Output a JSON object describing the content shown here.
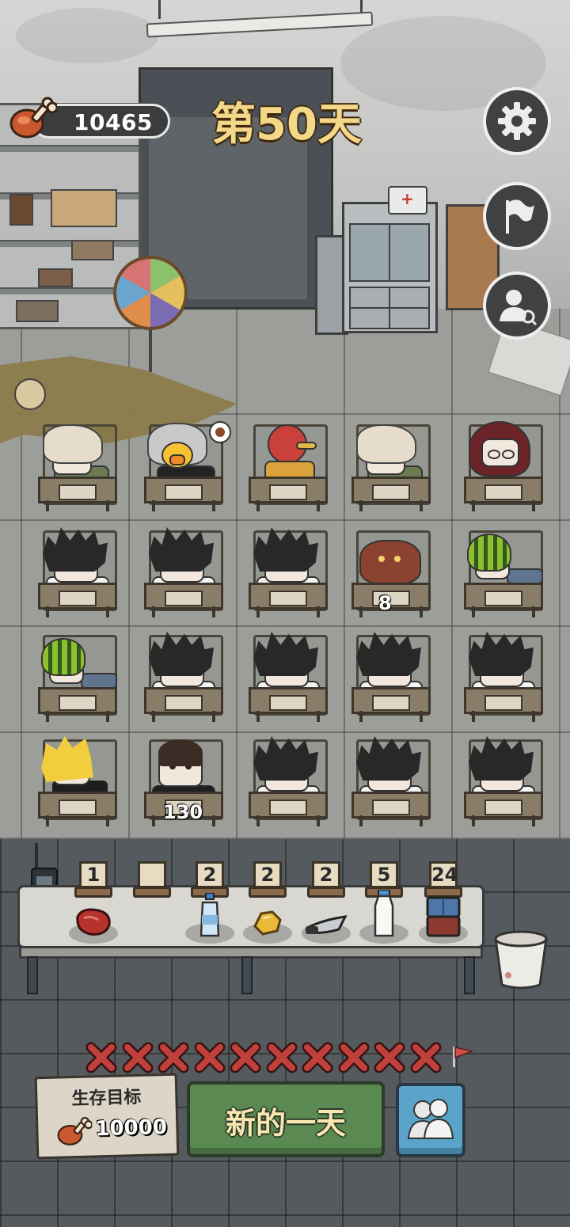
{
  "hud": {
    "food_amount": "10465",
    "day_label": "第50天",
    "food_icon": "meat-drumstick-icon",
    "settings_icon": "gear-icon",
    "flag_icon": "flag-icon",
    "profile_search_icon": "person-search-icon"
  },
  "characters": [
    {
      "row": 1,
      "col": 1,
      "type": "white-haired-girl"
    },
    {
      "row": 1,
      "col": 2,
      "type": "bird-masked-man",
      "badge": "food-ping-icon"
    },
    {
      "row": 1,
      "col": 3,
      "type": "red-bird"
    },
    {
      "row": 1,
      "col": 4,
      "type": "white-haired-girl"
    },
    {
      "row": 1,
      "col": 5,
      "type": "red-hooded-girl"
    },
    {
      "row": 2,
      "col": 1,
      "type": "black-haired-boy"
    },
    {
      "row": 2,
      "col": 2,
      "type": "black-haired-boy"
    },
    {
      "row": 2,
      "col": 3,
      "type": "black-haired-boy"
    },
    {
      "row": 2,
      "col": 4,
      "type": "brown-cat",
      "hp": "8"
    },
    {
      "row": 2,
      "col": 5,
      "type": "melon-head"
    },
    {
      "row": 3,
      "col": 1,
      "type": "melon-head"
    },
    {
      "row": 3,
      "col": 2,
      "type": "black-haired-boy"
    },
    {
      "row": 3,
      "col": 3,
      "type": "black-haired-boy"
    },
    {
      "row": 3,
      "col": 4,
      "type": "black-haired-boy"
    },
    {
      "row": 3,
      "col": 5,
      "type": "black-haired-boy"
    },
    {
      "row": 4,
      "col": 1,
      "type": "blonde-caped-boy"
    },
    {
      "row": 4,
      "col": 2,
      "type": "bowl-cut-boy",
      "hp": "130"
    },
    {
      "row": 4,
      "col": 3,
      "type": "black-haired-boy"
    },
    {
      "row": 4,
      "col": 4,
      "type": "black-haired-boy"
    },
    {
      "row": 4,
      "col": 5,
      "type": "black-haired-boy"
    }
  ],
  "supplies": [
    {
      "icon": "raw-meat-icon",
      "count": "1"
    },
    {
      "icon": "empty-slot",
      "count": ""
    },
    {
      "icon": "water-bottle-icon",
      "count": "2"
    },
    {
      "icon": "gold-nugget-icon",
      "count": "2"
    },
    {
      "icon": "knife-icon",
      "count": "2"
    },
    {
      "icon": "milk-bottle-icon",
      "count": "5"
    },
    {
      "icon": "jeans-icon",
      "count": "24"
    }
  ],
  "progress": {
    "failed_days": 10,
    "marker_icon": "x-mark-icon",
    "goal_flag_icon": "red-flag-icon"
  },
  "goal": {
    "title": "生存目标",
    "value": "10000"
  },
  "buttons": {
    "new_day": "新的一天",
    "people_icon": "people-icon"
  },
  "colors": {
    "day_text": "#f3d88a",
    "new_day_button": "#5a8a52",
    "people_button": "#5aa3c9",
    "x_mark": "#c0413b"
  }
}
